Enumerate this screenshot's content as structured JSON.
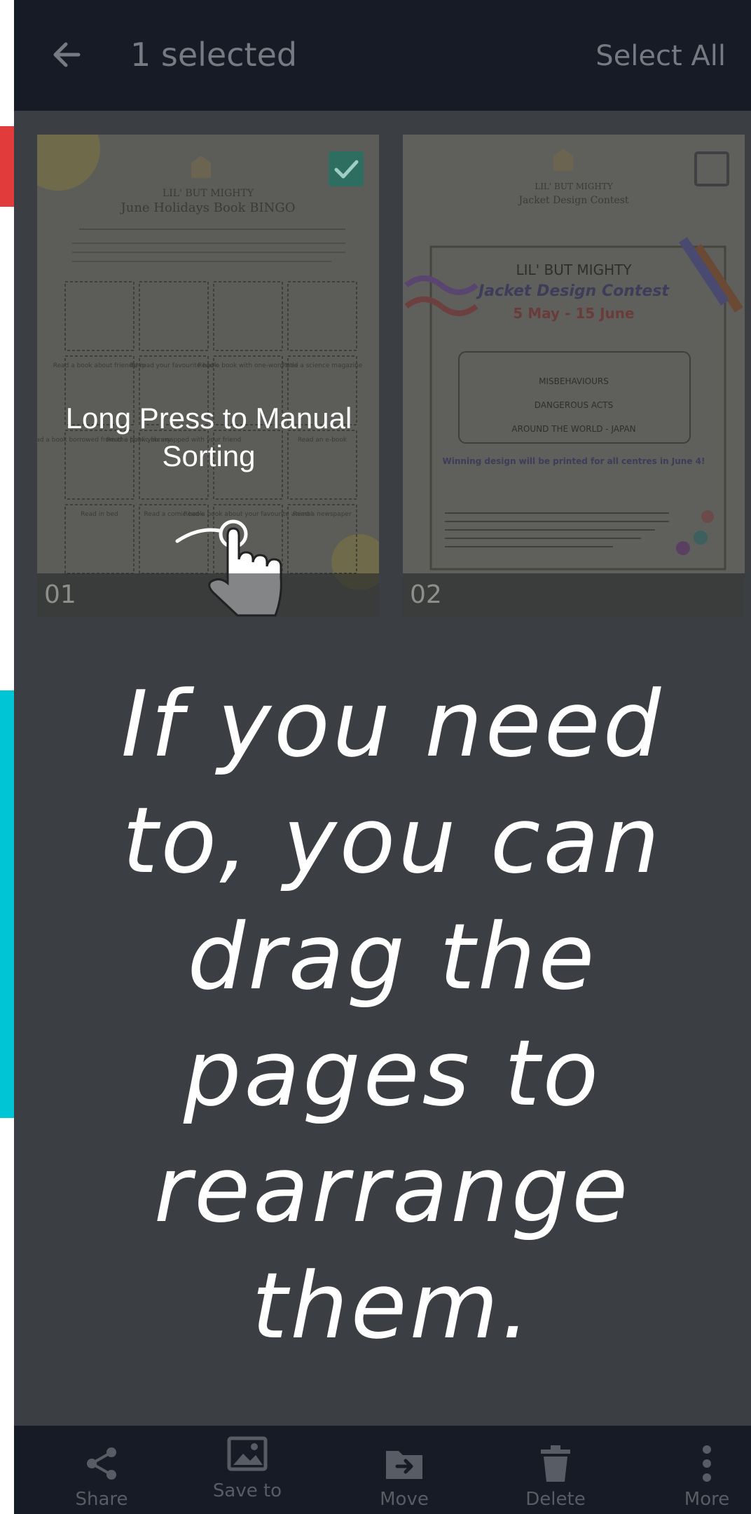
{
  "header": {
    "title": "1 selected",
    "select_all": "Select All",
    "back_icon": "back-arrow-icon"
  },
  "pages": [
    {
      "number": "01",
      "selected": true,
      "top_line": "LIL' BUT MIGHTY",
      "heading": "June Holidays Book BINGO",
      "tiles": [
        "Read a book about friendship",
        "Re-read your favourite book",
        "Read a book with one-word title",
        "Read a science magazine",
        "Read a book borrowed from the public library",
        "Read a book you swapped with your friend",
        "Read an e-book",
        "Read in bed",
        "Read a comic book",
        "Read a book about your favourite animal",
        "Read a newspaper"
      ],
      "hint": "Long Press to Manual Sorting"
    },
    {
      "number": "02",
      "selected": false,
      "top_line": "LIL' BUT MIGHTY",
      "heading": "Jacket Design Contest",
      "dates": "5 May - 15 June",
      "themes": [
        "MISBEHAVIOURS",
        "DANGEROUS ACTS",
        "AROUND THE WORLD - JAPAN"
      ],
      "prize": "Winning design will be printed for all centres in June 4!"
    }
  ],
  "caption": {
    "lines": [
      "If you need",
      "to, you can",
      "drag the",
      "pages to",
      "rearrange",
      "them."
    ]
  },
  "bottom_bar": {
    "items": [
      {
        "label": "Share",
        "icon": "share-icon"
      },
      {
        "label": "Save to",
        "icon": "save-image-icon"
      },
      {
        "label": "Move",
        "icon": "move-folder-icon"
      },
      {
        "label": "Delete",
        "icon": "trash-icon"
      },
      {
        "label": "More",
        "icon": "more-vertical-icon"
      }
    ]
  },
  "colors": {
    "topbar": "#171b26",
    "overlay": "#3b3e43",
    "check": "#2ec4a6",
    "edge_red": "#e23b3b",
    "edge_cyan": "#00c5d4"
  }
}
